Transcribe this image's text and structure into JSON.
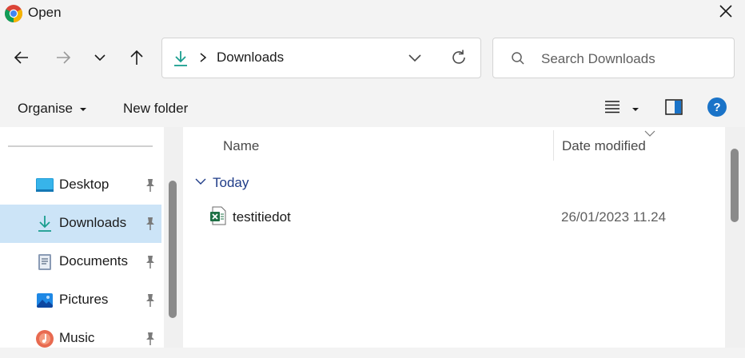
{
  "window": {
    "title": "Open",
    "icon": "chrome-icon"
  },
  "address": {
    "location_icon": "downloads-icon",
    "path_label": "Downloads"
  },
  "search": {
    "placeholder": "Search Downloads"
  },
  "toolbar": {
    "organise_label": "Organise",
    "new_folder_label": "New folder"
  },
  "sidebar": {
    "items": [
      {
        "label": "Desktop",
        "icon": "desktop-icon",
        "pinned": true,
        "selected": false
      },
      {
        "label": "Downloads",
        "icon": "downloads-icon",
        "pinned": true,
        "selected": true
      },
      {
        "label": "Documents",
        "icon": "documents-icon",
        "pinned": true,
        "selected": false
      },
      {
        "label": "Pictures",
        "icon": "pictures-icon",
        "pinned": true,
        "selected": false
      },
      {
        "label": "Music",
        "icon": "music-icon",
        "pinned": true,
        "selected": false
      }
    ]
  },
  "columns": {
    "name": "Name",
    "date_modified": "Date modified"
  },
  "groups": [
    {
      "label": "Today",
      "files": [
        {
          "name": "testitiedot",
          "date_modified": "26/01/2023 11.24",
          "icon": "excel-file-icon"
        }
      ]
    }
  ],
  "colors": {
    "accent": "#0067c0",
    "selection": "#cce4f7",
    "group_header": "#1f3c88"
  }
}
